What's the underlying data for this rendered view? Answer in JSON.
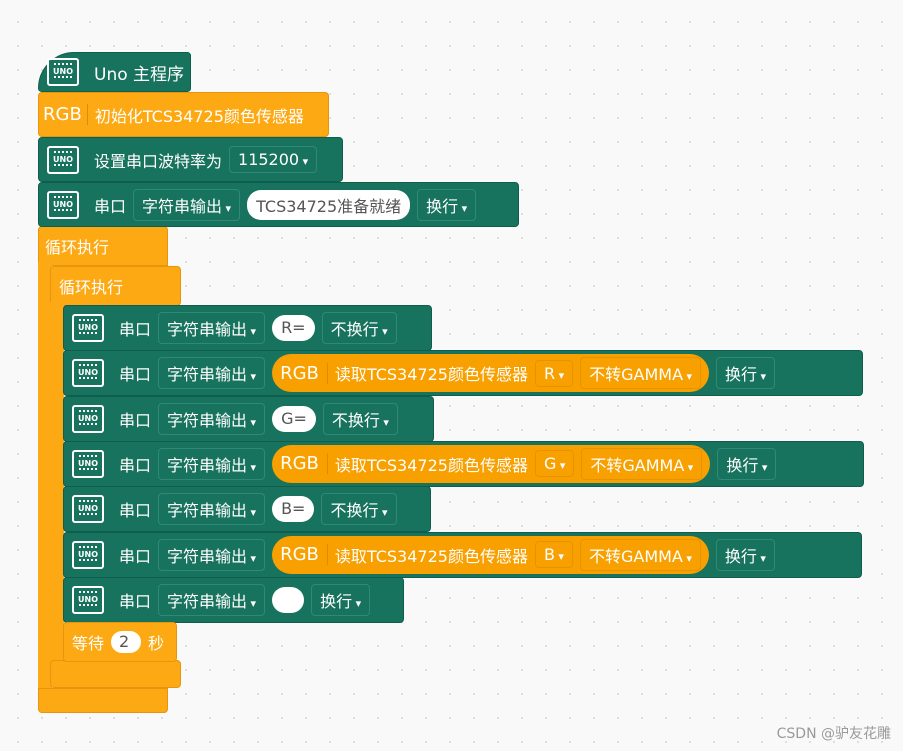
{
  "colors": {
    "device_block": "#17735d",
    "control_block": "#fda914",
    "sensor_reporter": "#f7a000"
  },
  "hat": {
    "icon": "uno-board-icon",
    "icon_text": "UNO",
    "label": "Uno 主程序"
  },
  "init": {
    "tag": "RGB",
    "label": "初始化TCS34725颜色传感器"
  },
  "baud": {
    "label": "设置串口波特率为",
    "value": "115200"
  },
  "serial_ready": {
    "label": "串口",
    "mode": "字符串输出",
    "text": "TCS34725准备就绪",
    "newline": "换行"
  },
  "outer_loop": {
    "label": "循环执行"
  },
  "inner_loop": {
    "label": "循环执行"
  },
  "rows": [
    {
      "label": "串口",
      "mode": "字符串输出",
      "text": "R=",
      "newline": "不换行"
    },
    {
      "label": "串口",
      "mode": "字符串输出",
      "sensor": {
        "tag": "RGB",
        "label": "读取TCS34725颜色传感器",
        "channel": "R",
        "gamma": "不转GAMMA"
      },
      "newline": "换行"
    },
    {
      "label": "串口",
      "mode": "字符串输出",
      "text": "G=",
      "newline": "不换行"
    },
    {
      "label": "串口",
      "mode": "字符串输出",
      "sensor": {
        "tag": "RGB",
        "label": "读取TCS34725颜色传感器",
        "channel": "G",
        "gamma": "不转GAMMA"
      },
      "newline": "换行"
    },
    {
      "label": "串口",
      "mode": "字符串输出",
      "text": "B=",
      "newline": "不换行"
    },
    {
      "label": "串口",
      "mode": "字符串输出",
      "sensor": {
        "tag": "RGB",
        "label": "读取TCS34725颜色传感器",
        "channel": "B",
        "gamma": "不转GAMMA"
      },
      "newline": "换行"
    },
    {
      "label": "串口",
      "mode": "字符串输出",
      "text": "",
      "newline": "换行"
    }
  ],
  "wait": {
    "label": "等待",
    "value": "2",
    "unit": "秒"
  },
  "watermark": "CSDN @驴友花雕"
}
